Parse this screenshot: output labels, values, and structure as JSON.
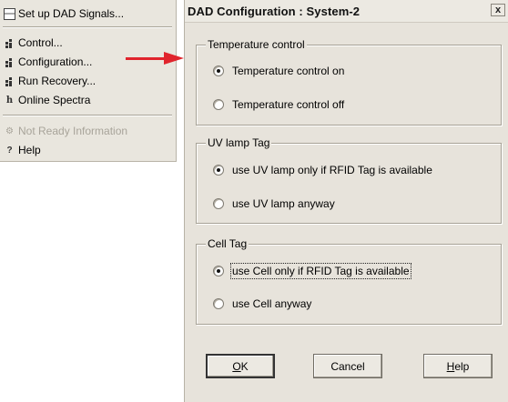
{
  "menu": {
    "items": [
      {
        "label": "Set up DAD Signals...",
        "icon": "signals-icon",
        "enabled": true
      },
      {
        "label": "Control...",
        "icon": "control-icon",
        "enabled": true
      },
      {
        "label": "Configuration...",
        "icon": "configuration-icon",
        "enabled": true
      },
      {
        "label": "Run Recovery...",
        "icon": "run-recovery-icon",
        "enabled": true
      },
      {
        "label": "Online Spectra",
        "icon": "spectra-icon",
        "enabled": true
      },
      {
        "label": "Not Ready Information",
        "icon": "not-ready-icon",
        "enabled": false
      },
      {
        "label": "Help",
        "icon": "help-icon",
        "enabled": true
      }
    ]
  },
  "annotation": {
    "color": "#e0242c"
  },
  "dialog": {
    "title": "DAD Configuration : System-2",
    "close_label": "x",
    "groups": [
      {
        "label": "Temperature control",
        "options": [
          {
            "label": "Temperature control on",
            "selected": true
          },
          {
            "label": "Temperature control off",
            "selected": false
          }
        ]
      },
      {
        "label": "UV lamp Tag",
        "options": [
          {
            "label": "use UV lamp only if RFID Tag is available",
            "selected": true
          },
          {
            "label": "use UV lamp anyway",
            "selected": false
          }
        ]
      },
      {
        "label": "Cell Tag",
        "options": [
          {
            "label": "use Cell only if RFID Tag is available",
            "selected": true,
            "focused": true
          },
          {
            "label": "use Cell anyway",
            "selected": false
          }
        ]
      }
    ],
    "buttons": {
      "ok_accel": "O",
      "ok_rest": "K",
      "cancel": "Cancel",
      "help_accel": "H",
      "help_rest": "elp"
    }
  }
}
